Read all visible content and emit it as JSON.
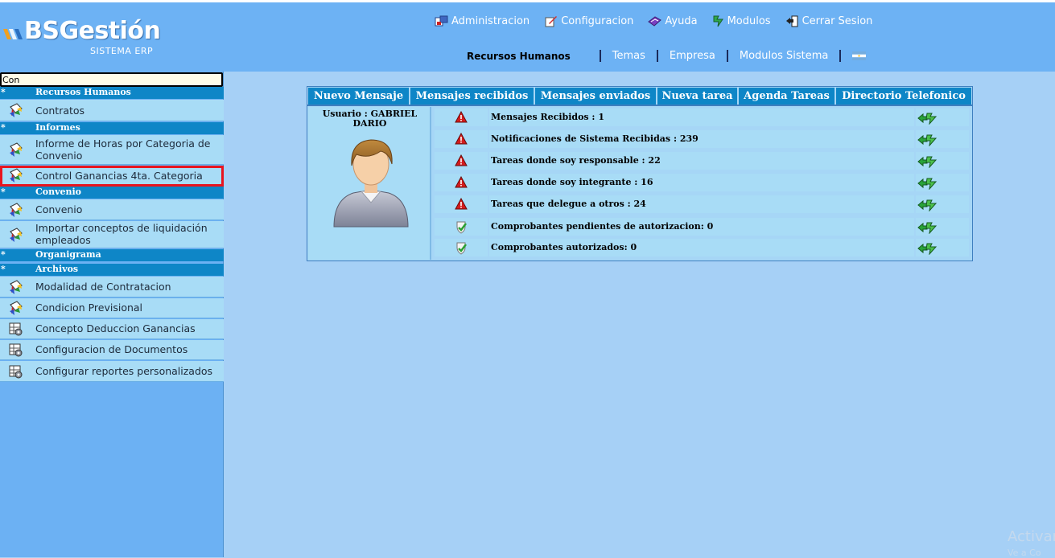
{
  "brand": {
    "name": "BSGestión",
    "subtitle": "SISTEMA ERP"
  },
  "top_menu": [
    {
      "label": "Administracion",
      "icon": "administration-icon"
    },
    {
      "label": "Configuracion",
      "icon": "configuration-icon"
    },
    {
      "label": "Ayuda",
      "icon": "help-icon"
    },
    {
      "label": "Modulos",
      "icon": "modules-icon"
    },
    {
      "label": "Cerrar Sesion",
      "icon": "logout-icon"
    }
  ],
  "subnav": {
    "current": "Recursos Humanos",
    "links": [
      "Temas",
      "Empresa",
      "Modulos Sistema"
    ],
    "flag_icon": "argentina-flag-icon"
  },
  "sidebar": {
    "search_value": "Con",
    "group_marker": "*",
    "groups": [
      {
        "label": "Recursos Humanos",
        "items": [
          {
            "label": "Contratos"
          }
        ]
      },
      {
        "label": "Informes",
        "items": [
          {
            "label": "Informe de Horas por Categoria de Convenio"
          },
          {
            "label": "Control Ganancias 4ta. Categoria",
            "selected": true
          }
        ]
      },
      {
        "label": "Convenio",
        "items": [
          {
            "label": "Convenio"
          },
          {
            "label": "Importar conceptos de liquidación empleados"
          }
        ]
      },
      {
        "label": "Organigrama",
        "items": []
      },
      {
        "label": "Archivos",
        "items": [
          {
            "label": "Modalidad de Contratacion"
          },
          {
            "label": "Condicion Previsional"
          },
          {
            "label": "Concepto Deduccion Ganancias"
          },
          {
            "label": "Configuracion de Documentos"
          },
          {
            "label": "Configurar reportes personalizados"
          }
        ]
      }
    ]
  },
  "panel": {
    "tabs": [
      "Nuevo Mensaje",
      "Mensajes recibidos",
      "Mensajes enviados",
      "Nueva tarea",
      "Agenda Tareas",
      "Directorio Telefonico"
    ],
    "user_label": "Usuario : GABRIEL DARIO",
    "rows": [
      {
        "text": "Mensajes Recibidos : 1",
        "status": "warning"
      },
      {
        "text": "Notificaciones de Sistema Recibidas : 239",
        "status": "warning"
      },
      {
        "text": "Tareas donde soy responsable : 22",
        "status": "warning"
      },
      {
        "text": "Tareas donde soy integrante : 16",
        "status": "warning"
      },
      {
        "text": "Tareas que delegue a otros : 24",
        "status": "warning"
      },
      {
        "text": "Comprobantes pendientes de autorizacion: 0",
        "status": "ok"
      },
      {
        "text": "Comprobantes autorizados: 0",
        "status": "ok"
      }
    ]
  },
  "watermark": {
    "line1": "Activar",
    "line2": "Ve a Co"
  },
  "colors": {
    "header": "#6db2f4",
    "tab": "#0e86c7",
    "cell": "#a8dcf6",
    "selected_outline": "#e8141e"
  }
}
